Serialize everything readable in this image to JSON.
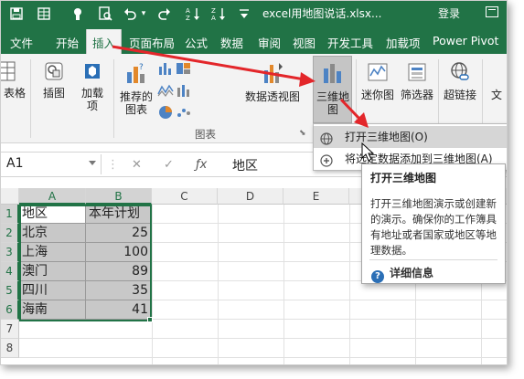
{
  "window": {
    "title": "excel用地图说话.xlsx...",
    "login_label": "登录"
  },
  "tabs": [
    {
      "label": "文件"
    },
    {
      "label": "开始"
    },
    {
      "label": "插入",
      "active": true
    },
    {
      "label": "页面布局"
    },
    {
      "label": "公式"
    },
    {
      "label": "数据"
    },
    {
      "label": "审阅"
    },
    {
      "label": "视图"
    },
    {
      "label": "开发工具"
    },
    {
      "label": "加载项"
    },
    {
      "label": "Power Pivot"
    }
  ],
  "ribbon": {
    "table_label": "表格",
    "illustrations_label": "插图",
    "addins_label_1": "加载",
    "addins_label_2": "项",
    "recommended_charts_1": "推荐的",
    "recommended_charts_2": "图表",
    "pivotchart_label": "数据透视图",
    "map3d_label_1": "三维地",
    "map3d_label_2": "图",
    "sparklines_label": "迷你图",
    "filters_label": "筛选器",
    "hyperlink_label": "超链接",
    "text_label": "文",
    "charts_group_label": "图表"
  },
  "formula_bar": {
    "name_box": "A1",
    "formula_value": "地区"
  },
  "grid": {
    "columns": [
      "A",
      "B",
      "C",
      "D",
      "E"
    ],
    "rows": [
      "1",
      "2",
      "3",
      "4",
      "5",
      "6",
      "7",
      "8"
    ],
    "table": {
      "headers": [
        "地区",
        "本年计划"
      ],
      "rows": [
        {
          "region": "北京",
          "value": "25"
        },
        {
          "region": "上海",
          "value": "100"
        },
        {
          "region": "澳门",
          "value": "89"
        },
        {
          "region": "四川",
          "value": "35"
        },
        {
          "region": "海南",
          "value": "41"
        }
      ]
    }
  },
  "menu": {
    "open_3d_map": "打开三维地图(O)",
    "add_to_3d_map": "将选定数据添加到三维地图(A)"
  },
  "tooltip": {
    "title": "打开三维地图",
    "description": "打开三维地图演示或创建新的演示。确保你的工作簿具有地址或者国家或地区等地理数据。",
    "more_info": "详细信息"
  },
  "colors": {
    "excel_green": "#217346",
    "annotation_arrow": "#e3262a"
  }
}
